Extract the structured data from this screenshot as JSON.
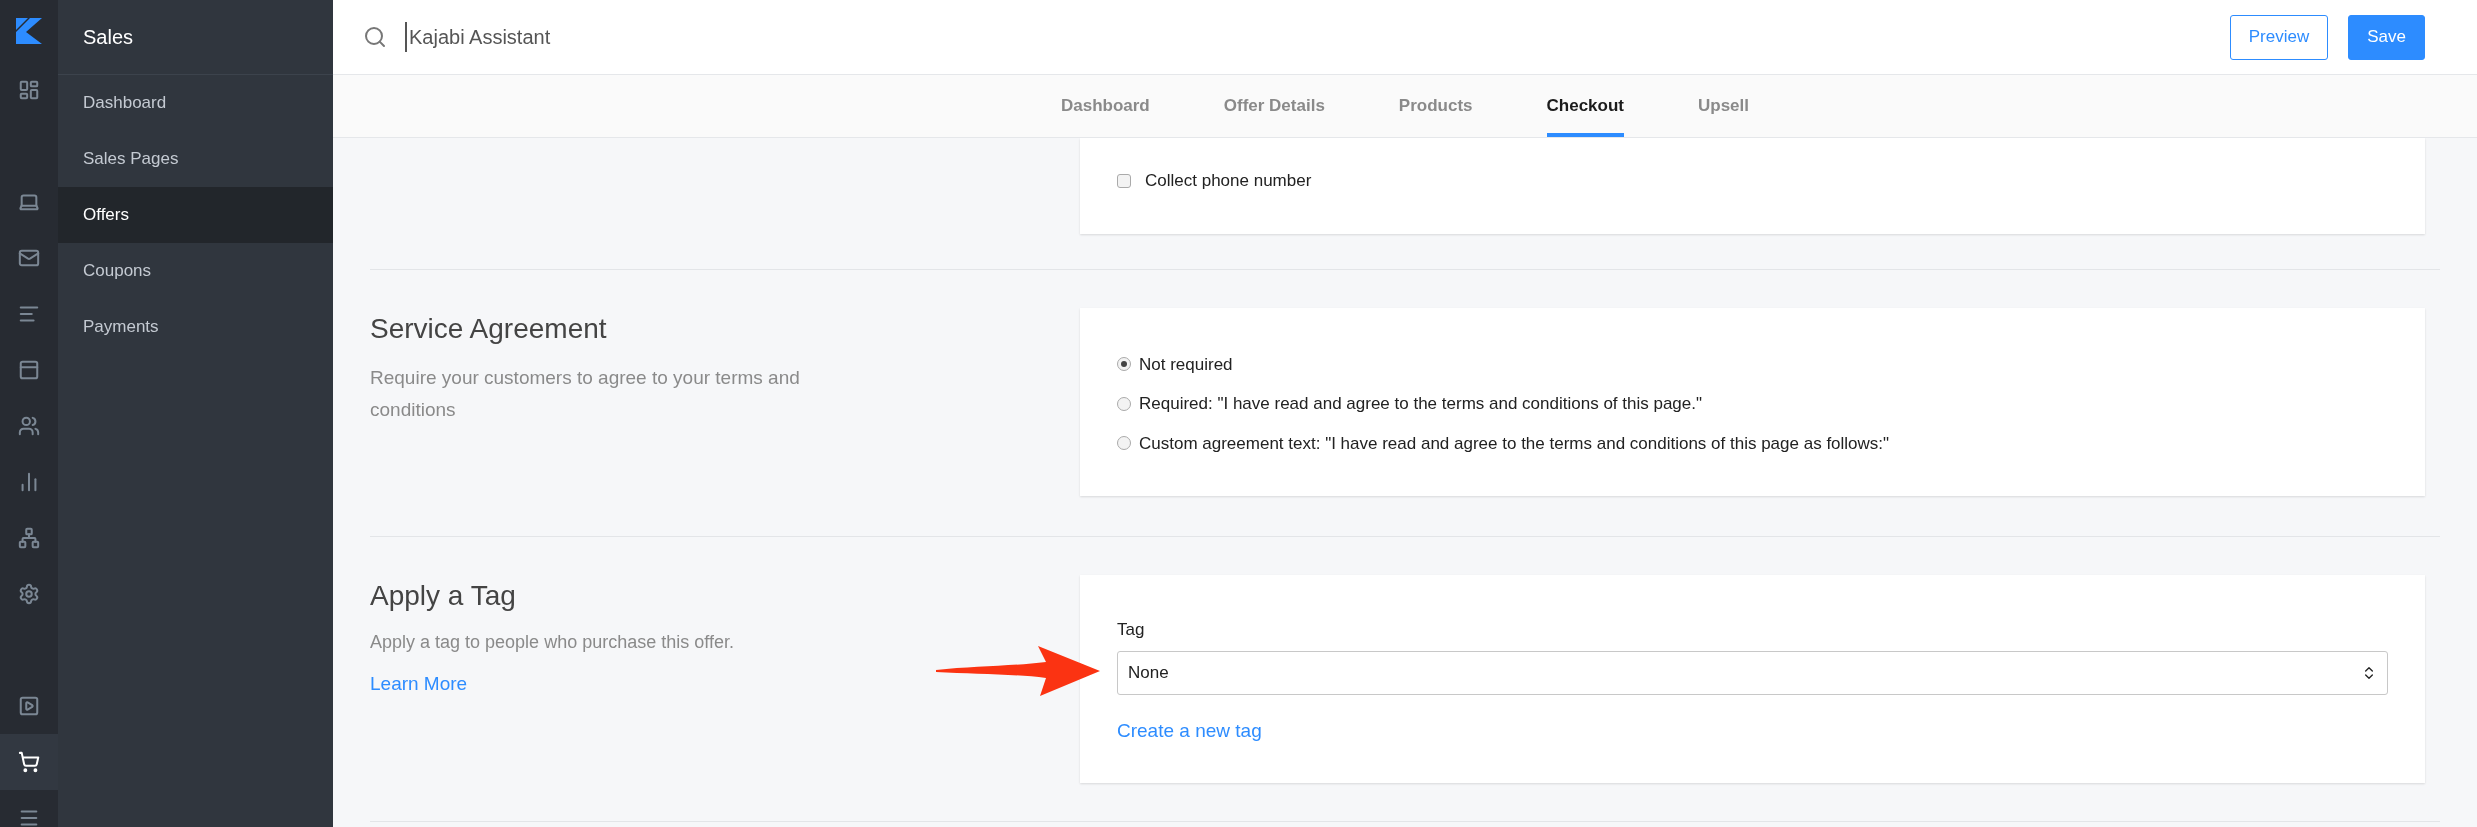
{
  "rail": [
    {
      "kind": "logo",
      "selected": false
    },
    {
      "kind": "dashboard",
      "selected": false
    },
    {
      "kind": "laptop",
      "selected": false
    },
    {
      "kind": "mail",
      "selected": false
    },
    {
      "kind": "list",
      "selected": false
    },
    {
      "kind": "browser",
      "selected": false
    },
    {
      "kind": "people",
      "selected": false
    },
    {
      "kind": "chart",
      "selected": false
    },
    {
      "kind": "network",
      "selected": false
    },
    {
      "kind": "settings",
      "selected": false
    },
    {
      "kind": "video",
      "selected": false
    },
    {
      "kind": "cart",
      "selected": true
    },
    {
      "kind": "menu",
      "selected": false
    }
  ],
  "sidebar": {
    "title": "Sales",
    "items": [
      {
        "label": "Dashboard",
        "selected": false
      },
      {
        "label": "Sales Pages",
        "selected": false
      },
      {
        "label": "Offers",
        "selected": true
      },
      {
        "label": "Coupons",
        "selected": false
      },
      {
        "label": "Payments",
        "selected": false
      }
    ]
  },
  "header": {
    "search": {
      "value": "Kajabi Assistant"
    },
    "buttons": [
      {
        "label": "Preview",
        "kind": "outline"
      },
      {
        "label": "Save",
        "kind": "primary"
      }
    ]
  },
  "tabs": [
    {
      "label": "Dashboard",
      "selected": false
    },
    {
      "label": "Offer Details",
      "selected": false
    },
    {
      "label": "Products",
      "selected": false
    },
    {
      "label": "Checkout",
      "selected": true
    },
    {
      "label": "Upsell",
      "selected": false
    }
  ],
  "top_card": {
    "checkbox": {
      "label": "Collect phone number",
      "checked": false
    }
  },
  "service_agreement": {
    "title": "Service Agreement",
    "description": "Require your customers to agree to your terms and conditions",
    "options": [
      {
        "label": "Not required",
        "selected": true
      },
      {
        "label": "Required: \"I have read and agree to the terms and conditions of this page.\"",
        "selected": false
      },
      {
        "label": "Custom agreement text: \"I have read and agree to the terms and conditions of this page as follows:\"",
        "selected": false
      }
    ]
  },
  "apply_tag": {
    "title": "Apply a Tag",
    "description": "Apply a tag to people who purchase this offer.",
    "link": "Learn More",
    "field_label": "Tag",
    "select_value": "None",
    "create_link": "Create a new tag"
  }
}
